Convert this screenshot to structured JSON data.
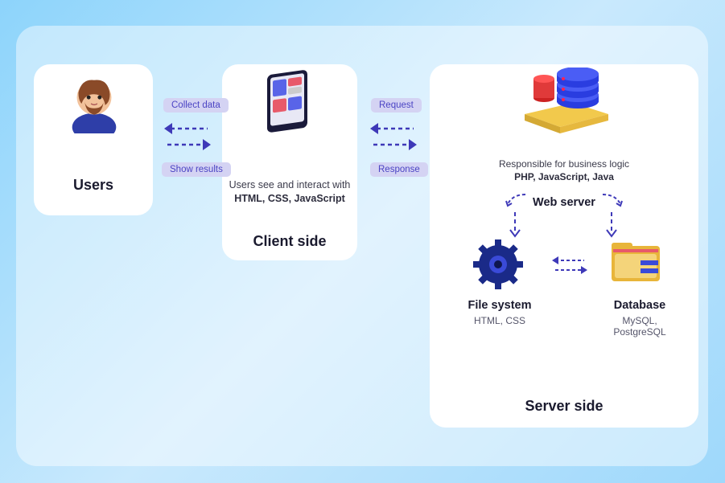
{
  "panels": {
    "users": {
      "title": "Users"
    },
    "client": {
      "title": "Client side",
      "caption_line1": "Users see and interact with",
      "caption_line2": "HTML, CSS, JavaScript"
    },
    "server": {
      "title": "Server side",
      "caption_line1": "Responsible for business logic",
      "caption_line2": "PHP, JavaScript, Java",
      "web_server": "Web server",
      "file_system": {
        "title": "File system",
        "tech": "HTML, CSS"
      },
      "database": {
        "title": "Database",
        "tech": "MySQL, PostgreSQL"
      }
    }
  },
  "flows": {
    "collect": "Collect data",
    "show": "Show results",
    "request": "Request",
    "response": "Response"
  },
  "colors": {
    "accent": "#4b44c4",
    "badge_bg": "#d4d3f3",
    "dash": "#3e39b8"
  }
}
